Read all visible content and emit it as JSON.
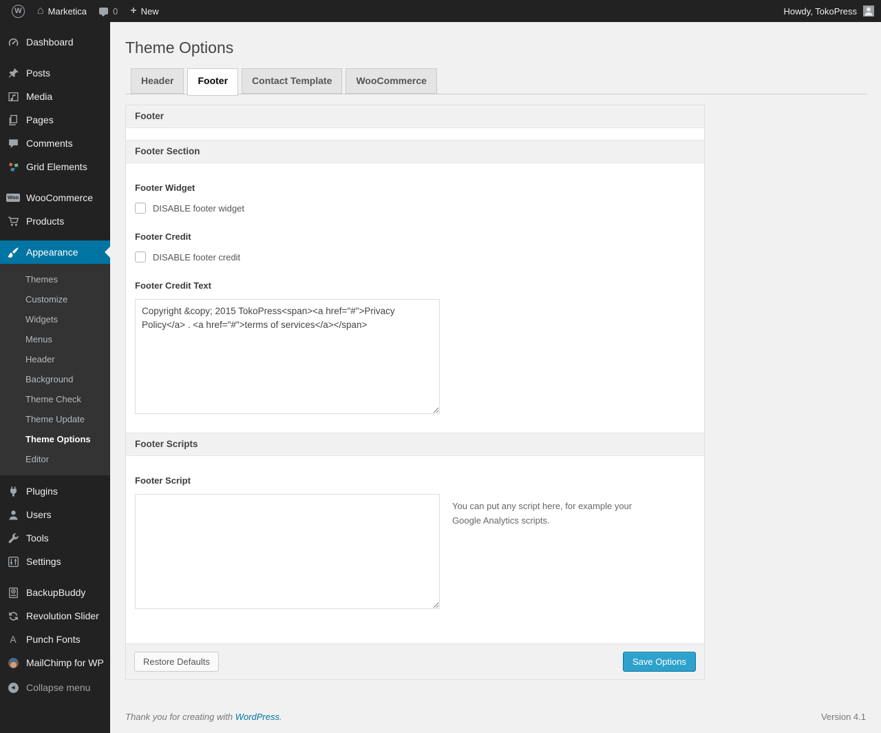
{
  "admin_bar": {
    "site_name": "Marketica",
    "comment_count": "0",
    "new_label": "New",
    "howdy": "Howdy, TokoPress"
  },
  "sidebar": {
    "groups": [
      {
        "items": [
          {
            "label": "Dashboard",
            "icon": "dashboard-icon"
          }
        ]
      },
      {
        "items": [
          {
            "label": "Posts",
            "icon": "posts-icon"
          },
          {
            "label": "Media",
            "icon": "media-icon"
          },
          {
            "label": "Pages",
            "icon": "pages-icon"
          },
          {
            "label": "Comments",
            "icon": "comments-icon"
          },
          {
            "label": "Grid Elements",
            "icon": "grid-elements-icon"
          }
        ]
      },
      {
        "items": [
          {
            "label": "WooCommerce",
            "icon": "woocommerce-icon"
          },
          {
            "label": "Products",
            "icon": "products-icon"
          }
        ]
      },
      {
        "items": [
          {
            "label": "Appearance",
            "icon": "appearance-icon",
            "active": true,
            "submenu": [
              "Themes",
              "Customize",
              "Widgets",
              "Menus",
              "Header",
              "Background",
              "Theme Check",
              "Theme Update",
              "Theme Options",
              "Editor"
            ],
            "submenu_current": "Theme Options"
          }
        ]
      },
      {
        "items": [
          {
            "label": "Plugins",
            "icon": "plugins-icon"
          },
          {
            "label": "Users",
            "icon": "users-icon"
          },
          {
            "label": "Tools",
            "icon": "tools-icon"
          },
          {
            "label": "Settings",
            "icon": "settings-icon"
          }
        ]
      },
      {
        "items": [
          {
            "label": "BackupBuddy",
            "icon": "backupbuddy-icon"
          },
          {
            "label": "Revolution Slider",
            "icon": "revolution-slider-icon"
          },
          {
            "label": "Punch Fonts",
            "icon": "punch-fonts-icon"
          },
          {
            "label": "MailChimp for WP",
            "icon": "mailchimp-icon"
          }
        ]
      },
      {
        "items": [
          {
            "label": "Collapse menu",
            "icon": "collapse-icon",
            "dim": true
          }
        ]
      }
    ]
  },
  "page": {
    "title": "Theme Options",
    "tabs": [
      {
        "label": "Header",
        "active": false
      },
      {
        "label": "Footer",
        "active": true
      },
      {
        "label": "Contact Template",
        "active": false
      },
      {
        "label": "WooCommerce",
        "active": false
      }
    ],
    "panel": {
      "box_title": "Footer",
      "section1_title": "Footer Section",
      "footer_widget_label": "Footer Widget",
      "footer_widget_checkbox": "DISABLE footer widget",
      "footer_credit_label": "Footer Credit",
      "footer_credit_checkbox": "DISABLE footer credit",
      "footer_credit_text_label": "Footer Credit Text",
      "footer_credit_text_value": "Copyright &copy; 2015 TokoPress<span><a href=\"#\">Privacy Policy</a> . <a href=\"#\">terms of services</a></span>",
      "section2_title": "Footer Scripts",
      "footer_script_label": "Footer Script",
      "footer_script_value": "",
      "footer_script_help": "You can put any script here, for example your Google Analytics scripts.",
      "restore_button": "Restore Defaults",
      "save_button": "Save Options"
    }
  },
  "footer": {
    "thanks_text": "Thank you for creating with ",
    "wordpress_label": "WordPress",
    "period": ".",
    "version": "Version 4.1"
  },
  "colors": {
    "accent_blue": "#0074a2",
    "primary_button": "#2ea2cc",
    "admin_bar_bg": "#222222",
    "sidebar_bg": "#222222",
    "submenu_bg": "#333333",
    "page_bg": "#f1f1f1"
  }
}
